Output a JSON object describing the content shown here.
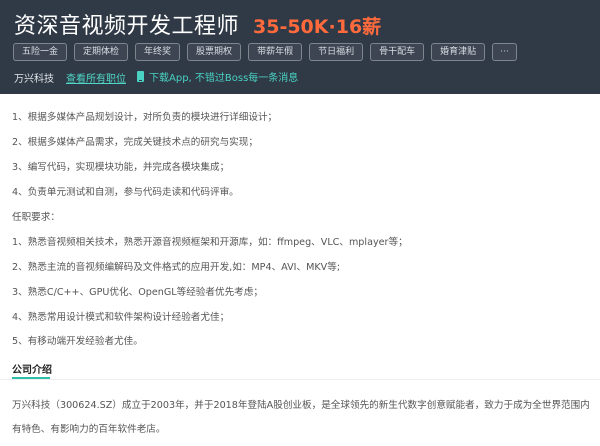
{
  "job": {
    "title": "资深音视频开发工程师",
    "salary": "35-50K·16薪"
  },
  "tags": [
    "五险一金",
    "定期体检",
    "年终奖",
    "股票期权",
    "带薪年假",
    "节日福利",
    "骨干配车",
    "婚育津贴",
    "···"
  ],
  "company": {
    "name": "万兴科技",
    "view_jobs_label": "查看所有职位",
    "app_promo": "下载App, 不错过Boss每一条消息"
  },
  "description": [
    "1、根据多媒体产品规划设计，对所负责的模块进行详细设计；",
    "2、根据多媒体产品需求，完成关键技术点的研究与实现；",
    "3、编写代码，实现模块功能，并完成各模块集成；",
    "4、负责单元测试和自测，参与代码走读和代码评审。",
    "任职要求：",
    "1、熟悉音视频相关技术，熟悉开源音视频框架和开源库，如：ffmpeg、VLC、mplayer等；",
    "2、熟悉主流的音视频编解码及文件格式的应用开发,如：MP4、AVI、MKV等;",
    "3、熟悉C/C++、GPU优化、OpenGL等经验者优先考虑；",
    "4、熟悉常用设计模式和软件架构设计经验者尤佳；",
    "5、有移动端开发经验者尤佳。"
  ],
  "company_intro": {
    "heading": "公司介绍",
    "lines": [
      "万兴科技（300624.SZ）成立于2003年，并于2018年登陆A股创业板，是全球领先的新生代数字创意赋能者，致力于成为全世界范围内",
      "有特色、有影响力的百年软件老店。"
    ]
  },
  "colors": {
    "header_bg": "#303a47",
    "salary": "#ff6a3d",
    "accent": "#2fbfab",
    "link": "#4fd6c6"
  }
}
